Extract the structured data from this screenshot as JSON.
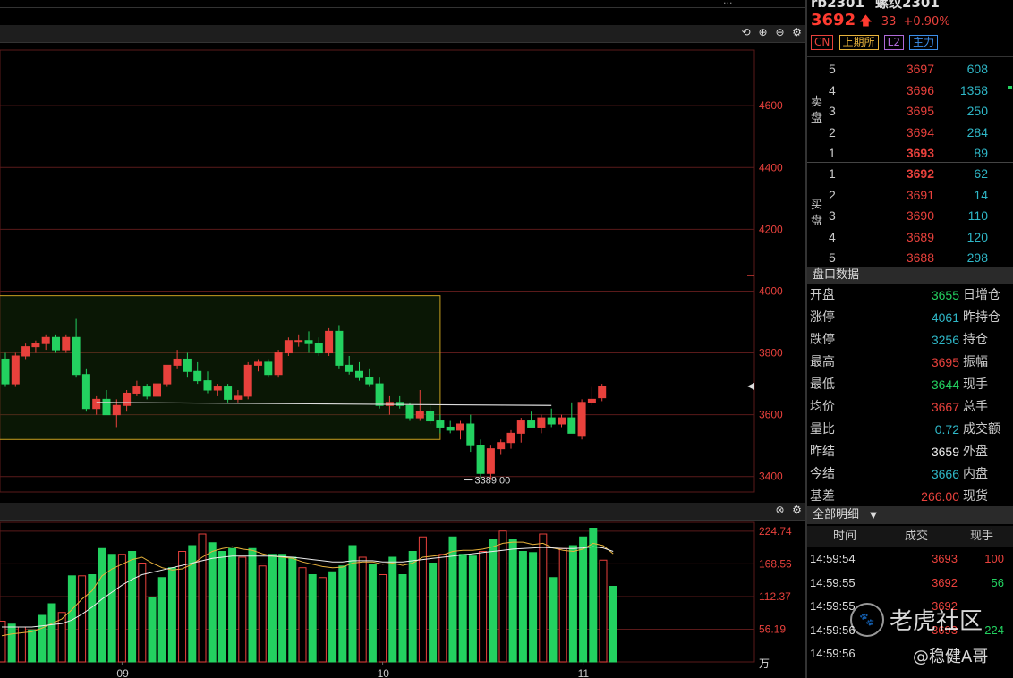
{
  "header": {
    "symbol": "rb2301",
    "name": "螺纹2301",
    "top_label": "...",
    "price": "3692",
    "change": "33",
    "change_pct": "+0.90%"
  },
  "tags": [
    {
      "label": "CN",
      "color": "#e8413c"
    },
    {
      "label": "上期所",
      "color": "#e8b33c"
    },
    {
      "label": "L2",
      "color": "#b06ad8"
    },
    {
      "label": "主力",
      "color": "#3c8de8"
    }
  ],
  "chart_toolbar": {
    "icons": [
      "undo-icon",
      "zoom-in-icon",
      "zoom-out-icon",
      "gear-icon"
    ],
    "glyphs": [
      "⟲",
      "⊕",
      "⊖",
      "⚙"
    ]
  },
  "volume_toolbar": {
    "glyphs": [
      "⊗",
      "⚙"
    ]
  },
  "chart_data": [
    {
      "type": "candlestick",
      "ylim": [
        3350,
        4780
      ],
      "yticks": [
        3400,
        3600,
        3800,
        4000,
        4200,
        4400,
        4600
      ],
      "x_ticks": [
        {
          "label": "09",
          "index": 7
        },
        {
          "label": "10",
          "index": 29
        },
        {
          "label": "11",
          "index": 45
        }
      ],
      "annotation": {
        "label": "3389.00",
        "value": 3389,
        "index": 45
      },
      "highlight_box": {
        "x_from_index": -1,
        "x_to_index": 43,
        "y_from": 3520,
        "y_to": 3985
      },
      "reference_line": {
        "value": 3630,
        "from_index": 9,
        "to_index": 54
      },
      "candles": [
        [
          3780,
          3800,
          3690,
          3700
        ],
        [
          3700,
          3800,
          3690,
          3790
        ],
        [
          3790,
          3830,
          3780,
          3820
        ],
        [
          3820,
          3840,
          3800,
          3830
        ],
        [
          3830,
          3860,
          3810,
          3850
        ],
        [
          3850,
          3860,
          3800,
          3810
        ],
        [
          3810,
          3860,
          3800,
          3850
        ],
        [
          3850,
          3910,
          3720,
          3730
        ],
        [
          3730,
          3750,
          3610,
          3620
        ],
        [
          3620,
          3660,
          3600,
          3650
        ],
        [
          3650,
          3680,
          3600,
          3600
        ],
        [
          3600,
          3650,
          3560,
          3630
        ],
        [
          3630,
          3680,
          3610,
          3670
        ],
        [
          3670,
          3710,
          3660,
          3690
        ],
        [
          3690,
          3700,
          3650,
          3660
        ],
        [
          3660,
          3700,
          3640,
          3700
        ],
        [
          3700,
          3760,
          3690,
          3760
        ],
        [
          3760,
          3810,
          3750,
          3780
        ],
        [
          3780,
          3800,
          3720,
          3740
        ],
        [
          3740,
          3770,
          3700,
          3710
        ],
        [
          3710,
          3740,
          3670,
          3680
        ],
        [
          3680,
          3700,
          3660,
          3690
        ],
        [
          3690,
          3700,
          3640,
          3650
        ],
        [
          3650,
          3680,
          3640,
          3660
        ],
        [
          3660,
          3770,
          3650,
          3760
        ],
        [
          3760,
          3780,
          3740,
          3770
        ],
        [
          3770,
          3780,
          3720,
          3730
        ],
        [
          3730,
          3810,
          3720,
          3800
        ],
        [
          3800,
          3850,
          3790,
          3840
        ],
        [
          3840,
          3860,
          3820,
          3840
        ],
        [
          3840,
          3870,
          3800,
          3830
        ],
        [
          3830,
          3850,
          3790,
          3800
        ],
        [
          3800,
          3880,
          3790,
          3870
        ],
        [
          3870,
          3890,
          3750,
          3760
        ],
        [
          3760,
          3790,
          3730,
          3740
        ],
        [
          3740,
          3770,
          3710,
          3720
        ],
        [
          3720,
          3750,
          3690,
          3700
        ],
        [
          3700,
          3720,
          3620,
          3630
        ],
        [
          3630,
          3660,
          3600,
          3640
        ],
        [
          3640,
          3660,
          3620,
          3630
        ],
        [
          3630,
          3640,
          3580,
          3590
        ],
        [
          3590,
          3680,
          3580,
          3610
        ],
        [
          3610,
          3630,
          3570,
          3580
        ],
        [
          3580,
          3600,
          3540,
          3560
        ],
        [
          3560,
          3580,
          3540,
          3550
        ],
        [
          3550,
          3580,
          3520,
          3570
        ],
        [
          3570,
          3600,
          3480,
          3500
        ],
        [
          3500,
          3520,
          3390,
          3410
        ],
        [
          3410,
          3500,
          3389,
          3490
        ],
        [
          3490,
          3520,
          3470,
          3510
        ],
        [
          3510,
          3550,
          3490,
          3540
        ],
        [
          3540,
          3590,
          3510,
          3580
        ],
        [
          3580,
          3610,
          3560,
          3560
        ],
        [
          3560,
          3600,
          3540,
          3590
        ],
        [
          3590,
          3620,
          3560,
          3570
        ],
        [
          3570,
          3600,
          3560,
          3590
        ],
        [
          3590,
          3640,
          3540,
          3540
        ],
        [
          3530,
          3650,
          3520,
          3640
        ],
        [
          3640,
          3690,
          3630,
          3650
        ],
        [
          3655,
          3700,
          3644,
          3692
        ]
      ]
    },
    {
      "type": "bar",
      "ylim": [
        0,
        240
      ],
      "yticks": [
        56.19,
        112.37,
        168.56,
        224.74
      ],
      "unit": "万",
      "values": [
        70,
        65,
        60,
        55,
        80,
        100,
        85,
        148,
        148,
        150,
        195,
        185,
        185,
        190,
        170,
        110,
        145,
        162,
        190,
        200,
        220,
        205,
        190,
        195,
        180,
        195,
        165,
        185,
        185,
        180,
        162,
        150,
        145,
        155,
        165,
        200,
        180,
        168,
        150,
        180,
        150,
        190,
        215,
        170,
        185,
        215,
        185,
        182,
        190,
        210,
        225,
        210,
        190,
        188,
        220,
        145,
        195,
        200,
        215,
        230,
        175,
        130
      ],
      "series": [
        {
          "color": "#e8b33c",
          "values": [
            45,
            48,
            50,
            52,
            58,
            66,
            74,
            90,
            108,
            122,
            148,
            160,
            168,
            176,
            180,
            170,
            162,
            158,
            160,
            168,
            180,
            190,
            195,
            198,
            194,
            192,
            186,
            182,
            180,
            178,
            172,
            168,
            164,
            162,
            163,
            170,
            172,
            172,
            168,
            170,
            166,
            170,
            180,
            182,
            184,
            190,
            192,
            192,
            194,
            198,
            204,
            206,
            206,
            202,
            204,
            196,
            192,
            190,
            194,
            204,
            200,
            186
          ]
        },
        {
          "color": "#eeeeee",
          "values": [
            60,
            60,
            60,
            60,
            62,
            64,
            66,
            72,
            82,
            94,
            108,
            120,
            132,
            142,
            150,
            154,
            158,
            162,
            166,
            170,
            174,
            178,
            180,
            182,
            182,
            182,
            182,
            182,
            181,
            180,
            178,
            176,
            174,
            172,
            172,
            174,
            174,
            174,
            172,
            172,
            172,
            174,
            176,
            178,
            180,
            182,
            184,
            186,
            188,
            190,
            192,
            194,
            195,
            196,
            197,
            196,
            195,
            195,
            196,
            198,
            196,
            190
          ]
        }
      ],
      "x_ticks": [
        {
          "label": "09",
          "index": 12
        },
        {
          "label": "10",
          "index": 38
        },
        {
          "label": "11",
          "index": 58
        }
      ]
    }
  ],
  "orderbook": {
    "sell_label": [
      "卖",
      "盘"
    ],
    "buy_label": [
      "买",
      "盘"
    ],
    "sells": [
      {
        "lvl": "5",
        "price": "3697",
        "qty": "608"
      },
      {
        "lvl": "4",
        "price": "3696",
        "qty": "1358"
      },
      {
        "lvl": "3",
        "price": "3695",
        "qty": "250"
      },
      {
        "lvl": "2",
        "price": "3694",
        "qty": "284"
      },
      {
        "lvl": "1",
        "price": "3693",
        "qty": "89"
      }
    ],
    "buys": [
      {
        "lvl": "1",
        "price": "3692",
        "qty": "62"
      },
      {
        "lvl": "2",
        "price": "3691",
        "qty": "14"
      },
      {
        "lvl": "3",
        "price": "3690",
        "qty": "110"
      },
      {
        "lvl": "4",
        "price": "3689",
        "qty": "120"
      },
      {
        "lvl": "5",
        "price": "3688",
        "qty": "298"
      }
    ]
  },
  "quote": {
    "title": "盘口数据",
    "rows": [
      {
        "label": "开盘",
        "value": "3655",
        "color": "green",
        "label2": "日增仓"
      },
      {
        "label": "涨停",
        "value": "4061",
        "color": "cyan",
        "label2": "昨持仓"
      },
      {
        "label": "跌停",
        "value": "3256",
        "color": "cyan",
        "label2": "持仓"
      },
      {
        "label": "最高",
        "value": "3695",
        "color": "red",
        "label2": "振幅"
      },
      {
        "label": "最低",
        "value": "3644",
        "color": "green",
        "label2": "现手"
      },
      {
        "label": "均价",
        "value": "3667",
        "color": "red",
        "label2": "总手"
      },
      {
        "label": "量比",
        "value": "0.72",
        "color": "cyan",
        "label2": "成交额"
      },
      {
        "label": "昨结",
        "value": "3659",
        "color": "white",
        "label2": "外盘"
      },
      {
        "label": "今结",
        "value": "3666",
        "color": "cyan",
        "label2": "内盘"
      },
      {
        "label": "基差",
        "value": "266.00",
        "color": "red",
        "label2": "现货"
      }
    ]
  },
  "trades": {
    "title": "全部明细",
    "headers": [
      "时间",
      "成交",
      "现手"
    ],
    "rows": [
      {
        "time": "14:59:54",
        "price": "3693",
        "qty": "100",
        "qcolor": "red"
      },
      {
        "time": "14:59:55",
        "price": "3692",
        "qty": "56",
        "qcolor": "green"
      },
      {
        "time": "14:59:55",
        "price": "3692",
        "qty": "",
        "qcolor": "green"
      },
      {
        "time": "14:59:56",
        "price": "3693",
        "qty": "224",
        "qcolor": "green"
      },
      {
        "time": "14:59:56",
        "price": "",
        "qty": "",
        "qcolor": "green"
      }
    ]
  },
  "watermark": {
    "brand": "老虎社区",
    "author": "@稳健A哥"
  },
  "colors": {
    "up": "#e8413c",
    "down": "#23d160",
    "grid": "#5a1a1a"
  }
}
